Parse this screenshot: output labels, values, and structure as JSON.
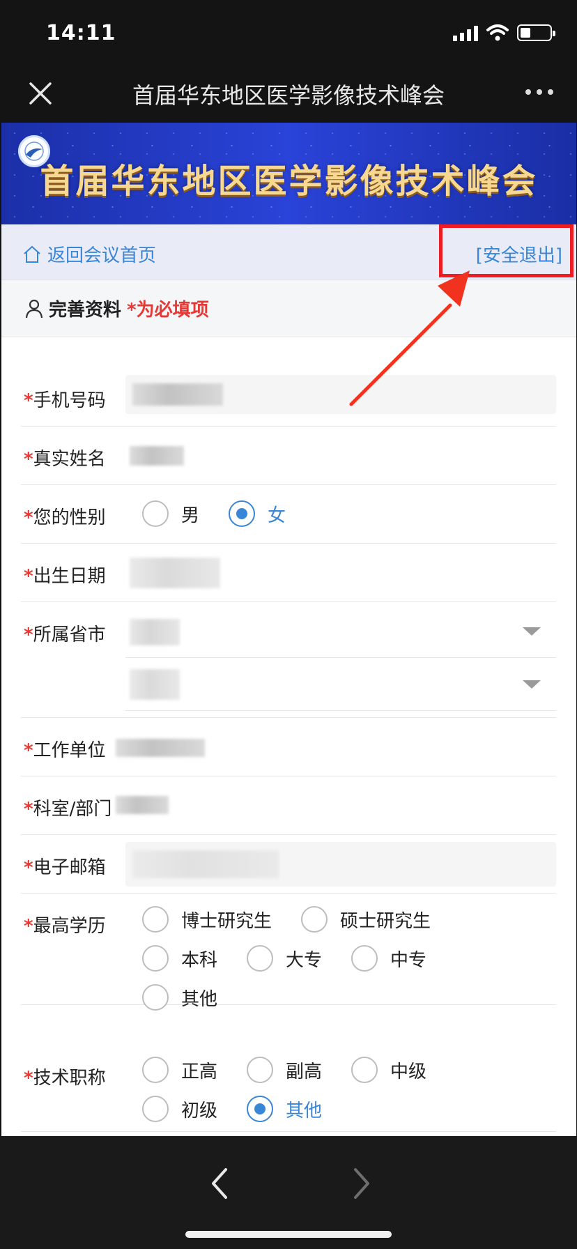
{
  "status_bar": {
    "time": "14:11"
  },
  "nav": {
    "title": "首届华东地区医学影像技术峰会",
    "close_icon": "close-icon",
    "more_icon": "more-icon"
  },
  "banner": {
    "title": "首届华东地区医学影像技术峰会"
  },
  "linkbar": {
    "back_label": "返回会议首页",
    "logout_label": "[安全退出]"
  },
  "section": {
    "title": "完善资料",
    "required_note": "*为必填项"
  },
  "form": {
    "required_mark": "*",
    "phone_label": "手机号码",
    "name_label": "真实姓名",
    "gender_label": "您的性别",
    "gender_options": [
      "男",
      "女"
    ],
    "gender_selected": "女",
    "birth_label": "出生日期",
    "region_label": "所属省市",
    "work_label": "工作单位",
    "dept_label": "科室/部门",
    "email_label": "电子邮箱",
    "education_label": "最高学历",
    "education_options": [
      "博士研究生",
      "硕士研究生",
      "本科",
      "大专",
      "中专",
      "其他"
    ],
    "title_label": "技术职称",
    "title_options": [
      "正高",
      "副高",
      "中级",
      "初级",
      "其他"
    ],
    "title_selected": "其他"
  },
  "colors": {
    "accent": "#3a86d6",
    "required": "#e53935",
    "highlight": "#ee1d24"
  }
}
